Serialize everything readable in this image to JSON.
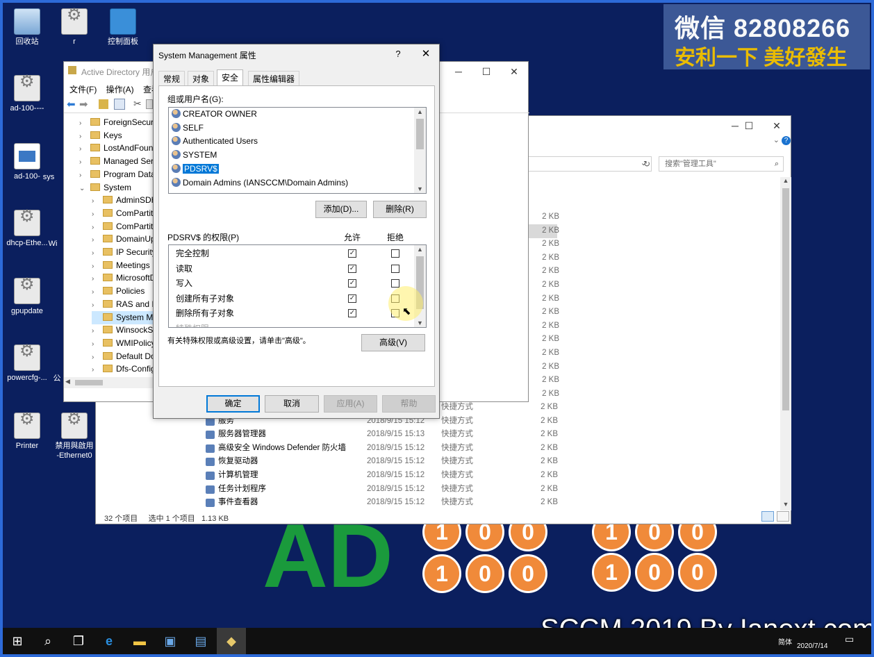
{
  "desktop": {
    "icons": [
      {
        "label": "回收站"
      },
      {
        "label": "r"
      },
      {
        "label": "控制面板"
      },
      {
        "label": "ad-100----"
      },
      {
        "label": "ad-100-"
      },
      {
        "label": "sys"
      },
      {
        "label": "dhcp-Ethe..."
      },
      {
        "label": "Wi"
      },
      {
        "label": "gpupdate"
      },
      {
        "label": "powercfg-..."
      },
      {
        "label": "公"
      },
      {
        "label": "Printer"
      },
      {
        "label": "禁用與啟用\n-Ethernet0"
      }
    ]
  },
  "banner": {
    "line1": "微信 82808266",
    "line2": "安利一下 美好發生"
  },
  "logo": {
    "text": "AD",
    "digits": [
      "1",
      "0",
      "0",
      "1",
      "0",
      "0"
    ],
    "circle_color": "#f08a3a",
    "text_color": "#1a9a3c"
  },
  "watermark": "SCCM 2019 By Ianext.com",
  "ad_window": {
    "title": "Active Directory 用户",
    "menu": [
      "文件(F)",
      "操作(A)",
      "查看"
    ],
    "tree": [
      {
        "label": "ForeignSecurit",
        "level": 1
      },
      {
        "label": "Keys",
        "level": 1
      },
      {
        "label": "LostAndFound",
        "level": 1
      },
      {
        "label": "Managed Ser",
        "level": 1
      },
      {
        "label": "Program Data",
        "level": 1
      },
      {
        "label": "System",
        "level": 1,
        "expanded": true
      },
      {
        "label": "AdminSDH",
        "level": 2
      },
      {
        "label": "ComPartiti",
        "level": 2
      },
      {
        "label": "ComPartiti",
        "level": 2
      },
      {
        "label": "DomainUp",
        "level": 2
      },
      {
        "label": "IP Security",
        "level": 2
      },
      {
        "label": "Meetings",
        "level": 2
      },
      {
        "label": "MicrosoftD",
        "level": 2
      },
      {
        "label": "Policies",
        "level": 2
      },
      {
        "label": "RAS and IA",
        "level": 2
      },
      {
        "label": "System Ma",
        "level": 2,
        "selected": true
      },
      {
        "label": "WinsockSe",
        "level": 2
      },
      {
        "label": "WMIPolicy",
        "level": 2
      },
      {
        "label": "Default Do",
        "level": 2
      },
      {
        "label": "Dfs-Config",
        "level": 2
      }
    ]
  },
  "explorer": {
    "search_placeholder": "搜索\"管理工具\"",
    "status": {
      "count": "32 个项目",
      "selected": "选中 1 个项目",
      "size": "1.13 KB"
    },
    "sizes_only": [
      "2 KB",
      "2 KB",
      "2 KB",
      "2 KB",
      "2 KB",
      "2 KB",
      "2 KB",
      "2 KB",
      "2 KB",
      "2 KB",
      "2 KB",
      "2 KB",
      "2 KB",
      "2 KB"
    ],
    "rows": [
      {
        "name": "",
        "date": "",
        "type": "快捷方式",
        "size": "2 KB"
      },
      {
        "name": "服务",
        "date": "2018/9/15 15:12",
        "type": "快捷方式",
        "size": "2 KB"
      },
      {
        "name": "服务器管理器",
        "date": "2018/9/15 15:13",
        "type": "快捷方式",
        "size": "2 KB"
      },
      {
        "name": "高级安全 Windows Defender 防火墙",
        "date": "2018/9/15 15:12",
        "type": "快捷方式",
        "size": "2 KB"
      },
      {
        "name": "恢复驱动器",
        "date": "2018/9/15 15:12",
        "type": "快捷方式",
        "size": "2 KB"
      },
      {
        "name": "计算机管理",
        "date": "2018/9/15 15:12",
        "type": "快捷方式",
        "size": "2 KB"
      },
      {
        "name": "任务计划程序",
        "date": "2018/9/15 15:12",
        "type": "快捷方式",
        "size": "2 KB"
      },
      {
        "name": "事件查看器",
        "date": "2018/9/15 15:12",
        "type": "快捷方式",
        "size": "2 KB"
      }
    ]
  },
  "dialog": {
    "title": "System Management 属性",
    "help": "?",
    "close": "✕",
    "tabs": [
      "常规",
      "对象",
      "安全",
      "属性编辑器"
    ],
    "active_tab": "安全",
    "group_label": "组或用户名(G):",
    "users": [
      {
        "name": "CREATOR OWNER"
      },
      {
        "name": "SELF"
      },
      {
        "name": "Authenticated Users"
      },
      {
        "name": "SYSTEM"
      },
      {
        "name": "PDSRV$",
        "selected": true
      },
      {
        "name": "Domain Admins (IANSCCM\\Domain Admins)"
      }
    ],
    "add_button": "添加(D)...",
    "remove_button": "删除(R)",
    "perm_label": "PDSRV$ 的权限(P)",
    "allow_header": "允许",
    "deny_header": "拒绝",
    "permissions": [
      {
        "name": "完全控制",
        "allow": true,
        "deny": false
      },
      {
        "name": "读取",
        "allow": true,
        "deny": false
      },
      {
        "name": "写入",
        "allow": true,
        "deny": false
      },
      {
        "name": "创建所有子对象",
        "allow": true,
        "deny": false
      },
      {
        "name": "删除所有子对象",
        "allow": true,
        "deny": false
      }
    ],
    "advanced_note": "有关特殊权限或高级设置，请单击\"高级\"。",
    "advanced_button": "高级(V)",
    "ok_button": "确定",
    "cancel_button": "取消",
    "apply_button": "应用(A)",
    "help_button": "帮助"
  },
  "taskbar": {
    "date": "2020/7/14",
    "ime": "简体",
    "icons": [
      "windows-start",
      "search",
      "task-view",
      "internet-explorer",
      "file-explorer",
      "ad-users",
      "server-manager",
      "dsa-tool"
    ]
  }
}
